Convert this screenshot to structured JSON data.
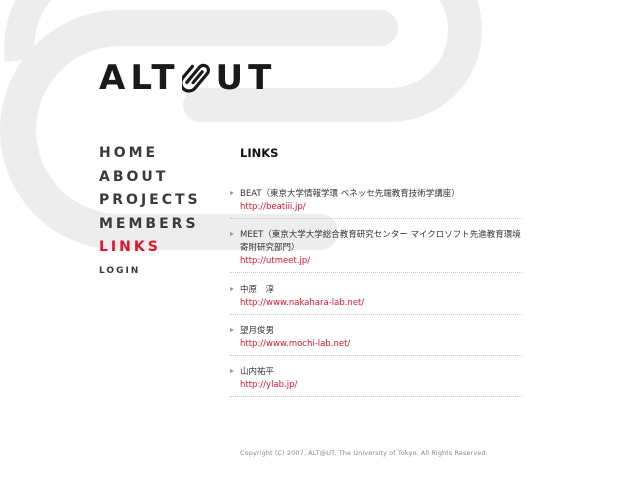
{
  "logo": {
    "part1": "ALT",
    "part2": "UT"
  },
  "nav": {
    "items": [
      {
        "label": "HOME"
      },
      {
        "label": "ABOUT"
      },
      {
        "label": "PROJECTS"
      },
      {
        "label": "MEMBERS"
      },
      {
        "label": "LINKS"
      }
    ],
    "active_index": 4,
    "login_label": "LOGIN"
  },
  "content": {
    "title": "LINKS",
    "links": [
      {
        "name": "BEAT（東京大学情報学環 ベネッセ先端教育技術学講座）",
        "url": "http://beatiii.jp/"
      },
      {
        "name": "MEET（東京大学大学総合教育研究センター マイクロソフト先進教育環境寄附研究部門）",
        "url": "http://utmeet.jp/"
      },
      {
        "name": "中原　淳",
        "url": "http://www.nakahara-lab.net/"
      },
      {
        "name": "望月俊男",
        "url": "http://www.mochi-lab.net/"
      },
      {
        "name": "山内祐平",
        "url": "http://ylab.jp/"
      }
    ]
  },
  "footer": {
    "copyright": "Copyright (C) 2007. ALT@UT. The University of Tokyo. All Rights Reserved."
  },
  "colors": {
    "accent": "#e0142c",
    "text": "#3a3a3a",
    "bg_graphic": "#ededed"
  }
}
